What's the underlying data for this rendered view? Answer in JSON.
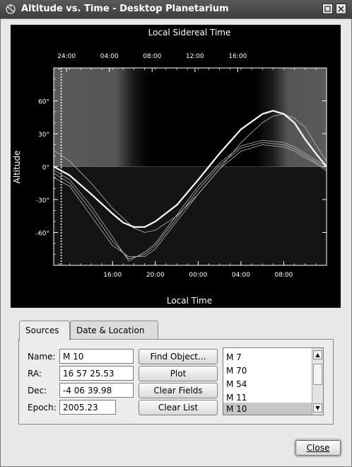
{
  "window": {
    "title": "Altitude vs. Time - Desktop Planetarium",
    "app_icon": "kstars-icon"
  },
  "chart_data": {
    "type": "line",
    "top_axis_title": "Local Sidereal Time",
    "top_ticks": [
      "24:00",
      "04:00",
      "08:00",
      "12:00",
      "16:00"
    ],
    "xlabel": "Local Time",
    "bottom_ticks": [
      "16:00",
      "20:00",
      "00:00",
      "04:00",
      "08:00"
    ],
    "ylabel": "Altitude",
    "y_ticks": [
      "60°",
      "30°",
      "0°",
      "-30°",
      "-60°"
    ],
    "ylim": [
      -90,
      90
    ],
    "x_hours_range": [
      10.5,
      12.0
    ],
    "current_time_marker": 11.2,
    "highlight_series": "M 10",
    "series": [
      {
        "name": "M 10",
        "x": [
          10.5,
          12,
          14,
          16,
          17,
          18,
          19,
          20,
          22,
          24,
          26,
          28,
          30,
          31,
          32,
          33,
          34,
          35,
          36
        ],
        "y": [
          0,
          -8,
          -25,
          -43,
          -51,
          -55,
          -55,
          -50,
          -35,
          -12,
          12,
          34,
          48,
          51,
          48,
          40,
          25,
          12,
          0
        ]
      },
      {
        "name": "M 7",
        "x": [
          10.5,
          12,
          14,
          16,
          17.5,
          19,
          20,
          22,
          24,
          26,
          28,
          30,
          32,
          33,
          34,
          35,
          36
        ],
        "y": [
          -10,
          -18,
          -45,
          -72,
          -82,
          -82,
          -75,
          -50,
          -25,
          -2,
          14,
          20,
          18,
          14,
          8,
          3,
          -4
        ]
      },
      {
        "name": "M 70",
        "x": [
          10.5,
          12,
          14,
          16,
          17.5,
          19,
          20,
          22,
          24,
          26,
          28,
          30,
          32,
          33,
          34,
          35,
          36
        ],
        "y": [
          -6,
          -15,
          -40,
          -68,
          -84,
          -80,
          -72,
          -47,
          -21,
          1,
          17,
          22,
          20,
          16,
          10,
          4,
          -2
        ]
      },
      {
        "name": "M 54",
        "x": [
          10.5,
          12,
          14,
          16,
          17.5,
          19,
          20,
          22,
          24,
          26,
          28,
          30,
          32,
          33,
          34,
          35,
          36
        ],
        "y": [
          -3,
          -12,
          -36,
          -64,
          -86,
          -78,
          -70,
          -44,
          -18,
          3,
          19,
          24,
          22,
          18,
          12,
          6,
          0
        ]
      },
      {
        "name": "M 11",
        "x": [
          10.5,
          12,
          14,
          16,
          18,
          19,
          20,
          22,
          24,
          26,
          28,
          30,
          31,
          32,
          33,
          34,
          35,
          36
        ],
        "y": [
          15,
          5,
          -15,
          -38,
          -56,
          -60,
          -58,
          -45,
          -25,
          -2,
          22,
          40,
          46,
          48,
          44,
          36,
          20,
          5
        ]
      }
    ]
  },
  "tabs": [
    "Sources",
    "Date & Location"
  ],
  "form": {
    "name_label": "Name:",
    "name_value": "M 10",
    "ra_label": "RA:",
    "ra_value": "16 57 25.53",
    "dec_label": "Dec:",
    "dec_value": "-4 06 39.98",
    "epoch_label": "Epoch:",
    "epoch_value": "2005.23"
  },
  "buttons": {
    "find_object": "Find Object...",
    "plot": "Plot",
    "clear_fields": "Clear Fields",
    "clear_list": "Clear List"
  },
  "object_list": {
    "items": [
      "M 7",
      "M 70",
      "M 54",
      "M 11",
      "M 10"
    ],
    "selected": "M 10"
  },
  "close_button": "Close"
}
